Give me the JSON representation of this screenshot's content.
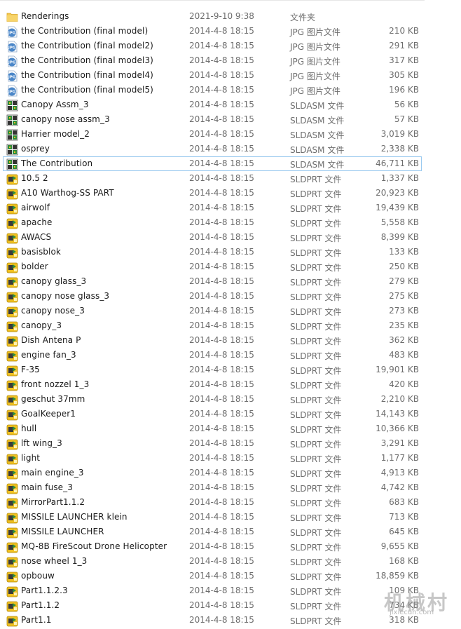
{
  "files": [
    {
      "name": "Renderings",
      "date": "2021-9-10 9:38",
      "type": "文件夹",
      "size": "",
      "icon": "folder-icon"
    },
    {
      "name": "the Contribution (final model)",
      "date": "2014-4-8 18:15",
      "type": "JPG 图片文件",
      "size": "210 KB",
      "icon": "jpg-file-icon"
    },
    {
      "name": "the Contribution (final model2)",
      "date": "2014-4-8 18:15",
      "type": "JPG 图片文件",
      "size": "291 KB",
      "icon": "jpg-file-icon"
    },
    {
      "name": "the Contribution (final model3)",
      "date": "2014-4-8 18:15",
      "type": "JPG 图片文件",
      "size": "317 KB",
      "icon": "jpg-file-icon"
    },
    {
      "name": "the Contribution (final model4)",
      "date": "2014-4-8 18:15",
      "type": "JPG 图片文件",
      "size": "305 KB",
      "icon": "jpg-file-icon"
    },
    {
      "name": "the Contribution (final model5)",
      "date": "2014-4-8 18:15",
      "type": "JPG 图片文件",
      "size": "196 KB",
      "icon": "jpg-file-icon"
    },
    {
      "name": "Canopy Assm_3",
      "date": "2014-4-8 18:15",
      "type": "SLDASM 文件",
      "size": "56 KB",
      "icon": "assembly-file-icon"
    },
    {
      "name": "canopy nose assm_3",
      "date": "2014-4-8 18:15",
      "type": "SLDASM 文件",
      "size": "57 KB",
      "icon": "assembly-file-icon"
    },
    {
      "name": "Harrier model_2",
      "date": "2014-4-8 18:15",
      "type": "SLDASM 文件",
      "size": "3,019 KB",
      "icon": "assembly-file-icon"
    },
    {
      "name": "osprey",
      "date": "2014-4-8 18:15",
      "type": "SLDASM 文件",
      "size": "2,338 KB",
      "icon": "assembly-file-icon"
    },
    {
      "name": "The Contribution",
      "date": "2014-4-8 18:15",
      "type": "SLDASM 文件",
      "size": "46,711 KB",
      "icon": "assembly-file-icon",
      "selected": true
    },
    {
      "name": "10.5 2",
      "date": "2014-4-8 18:15",
      "type": "SLDPRT 文件",
      "size": "1,337 KB",
      "icon": "part-file-icon"
    },
    {
      "name": "A10 Warthog-SS PART",
      "date": "2014-4-8 18:15",
      "type": "SLDPRT 文件",
      "size": "20,923 KB",
      "icon": "part-file-icon"
    },
    {
      "name": "airwolf",
      "date": "2014-4-8 18:15",
      "type": "SLDPRT 文件",
      "size": "19,439 KB",
      "icon": "part-file-icon"
    },
    {
      "name": "apache",
      "date": "2014-4-8 18:15",
      "type": "SLDPRT 文件",
      "size": "5,558 KB",
      "icon": "part-file-icon"
    },
    {
      "name": "AWACS",
      "date": "2014-4-8 18:15",
      "type": "SLDPRT 文件",
      "size": "8,399 KB",
      "icon": "part-file-icon"
    },
    {
      "name": "basisblok",
      "date": "2014-4-8 18:15",
      "type": "SLDPRT 文件",
      "size": "133 KB",
      "icon": "part-file-icon"
    },
    {
      "name": "bolder",
      "date": "2014-4-8 18:15",
      "type": "SLDPRT 文件",
      "size": "250 KB",
      "icon": "part-file-icon"
    },
    {
      "name": "canopy glass_3",
      "date": "2014-4-8 18:15",
      "type": "SLDPRT 文件",
      "size": "279 KB",
      "icon": "part-file-icon"
    },
    {
      "name": "canopy nose glass_3",
      "date": "2014-4-8 18:15",
      "type": "SLDPRT 文件",
      "size": "275 KB",
      "icon": "part-file-icon"
    },
    {
      "name": "canopy nose_3",
      "date": "2014-4-8 18:15",
      "type": "SLDPRT 文件",
      "size": "273 KB",
      "icon": "part-file-icon"
    },
    {
      "name": "canopy_3",
      "date": "2014-4-8 18:15",
      "type": "SLDPRT 文件",
      "size": "235 KB",
      "icon": "part-file-icon"
    },
    {
      "name": "Dish Antena P",
      "date": "2014-4-8 18:15",
      "type": "SLDPRT 文件",
      "size": "362 KB",
      "icon": "part-file-icon"
    },
    {
      "name": "engine fan_3",
      "date": "2014-4-8 18:15",
      "type": "SLDPRT 文件",
      "size": "483 KB",
      "icon": "part-file-icon"
    },
    {
      "name": "F-35",
      "date": "2014-4-8 18:15",
      "type": "SLDPRT 文件",
      "size": "19,901 KB",
      "icon": "part-file-icon"
    },
    {
      "name": "front nozzel 1_3",
      "date": "2014-4-8 18:15",
      "type": "SLDPRT 文件",
      "size": "420 KB",
      "icon": "part-file-icon"
    },
    {
      "name": "geschut 37mm",
      "date": "2014-4-8 18:15",
      "type": "SLDPRT 文件",
      "size": "2,210 KB",
      "icon": "part-file-icon"
    },
    {
      "name": "GoalKeeper1",
      "date": "2014-4-8 18:15",
      "type": "SLDPRT 文件",
      "size": "14,143 KB",
      "icon": "part-file-icon"
    },
    {
      "name": "hull",
      "date": "2014-4-8 18:15",
      "type": "SLDPRT 文件",
      "size": "10,366 KB",
      "icon": "part-file-icon"
    },
    {
      "name": "lft wing_3",
      "date": "2014-4-8 18:15",
      "type": "SLDPRT 文件",
      "size": "3,291 KB",
      "icon": "part-file-icon"
    },
    {
      "name": "light",
      "date": "2014-4-8 18:15",
      "type": "SLDPRT 文件",
      "size": "1,177 KB",
      "icon": "part-file-icon"
    },
    {
      "name": "main engine_3",
      "date": "2014-4-8 18:15",
      "type": "SLDPRT 文件",
      "size": "4,913 KB",
      "icon": "part-file-icon"
    },
    {
      "name": "main fuse_3",
      "date": "2014-4-8 18:15",
      "type": "SLDPRT 文件",
      "size": "4,742 KB",
      "icon": "part-file-icon"
    },
    {
      "name": "MirrorPart1.1.2",
      "date": "2014-4-8 18:15",
      "type": "SLDPRT 文件",
      "size": "683 KB",
      "icon": "part-file-icon"
    },
    {
      "name": "MISSILE LAUNCHER klein",
      "date": "2014-4-8 18:15",
      "type": "SLDPRT 文件",
      "size": "713 KB",
      "icon": "part-file-icon"
    },
    {
      "name": "MISSILE LAUNCHER",
      "date": "2014-4-8 18:15",
      "type": "SLDPRT 文件",
      "size": "645 KB",
      "icon": "part-file-icon"
    },
    {
      "name": "MQ-8B FireScout Drone Helicopter",
      "date": "2014-4-8 18:15",
      "type": "SLDPRT 文件",
      "size": "9,655 KB",
      "icon": "part-file-icon"
    },
    {
      "name": "nose wheel 1_3",
      "date": "2014-4-8 18:15",
      "type": "SLDPRT 文件",
      "size": "168 KB",
      "icon": "part-file-icon"
    },
    {
      "name": "opbouw",
      "date": "2014-4-8 18:15",
      "type": "SLDPRT 文件",
      "size": "18,859 KB",
      "icon": "part-file-icon"
    },
    {
      "name": "Part1.1.2.3",
      "date": "2014-4-8 18:15",
      "type": "SLDPRT 文件",
      "size": "109 KB",
      "icon": "part-file-icon"
    },
    {
      "name": "Part1.1.2",
      "date": "2014-4-8 18:15",
      "type": "SLDPRT 文件",
      "size": "734 KB",
      "icon": "part-file-icon"
    },
    {
      "name": "Part1.1",
      "date": "2014-4-8 18:15",
      "type": "SLDPRT 文件",
      "size": "318 KB",
      "icon": "part-file-icon"
    }
  ],
  "watermark": {
    "text": "机械村",
    "sub": "jixiecun.com"
  },
  "colors": {
    "selection_border": "#99c9ef",
    "folder": "#f3c64f",
    "jpg_badge": "#4a86c8",
    "part_yellow": "#f0c020",
    "assembly_green": "#2e8b3a"
  }
}
